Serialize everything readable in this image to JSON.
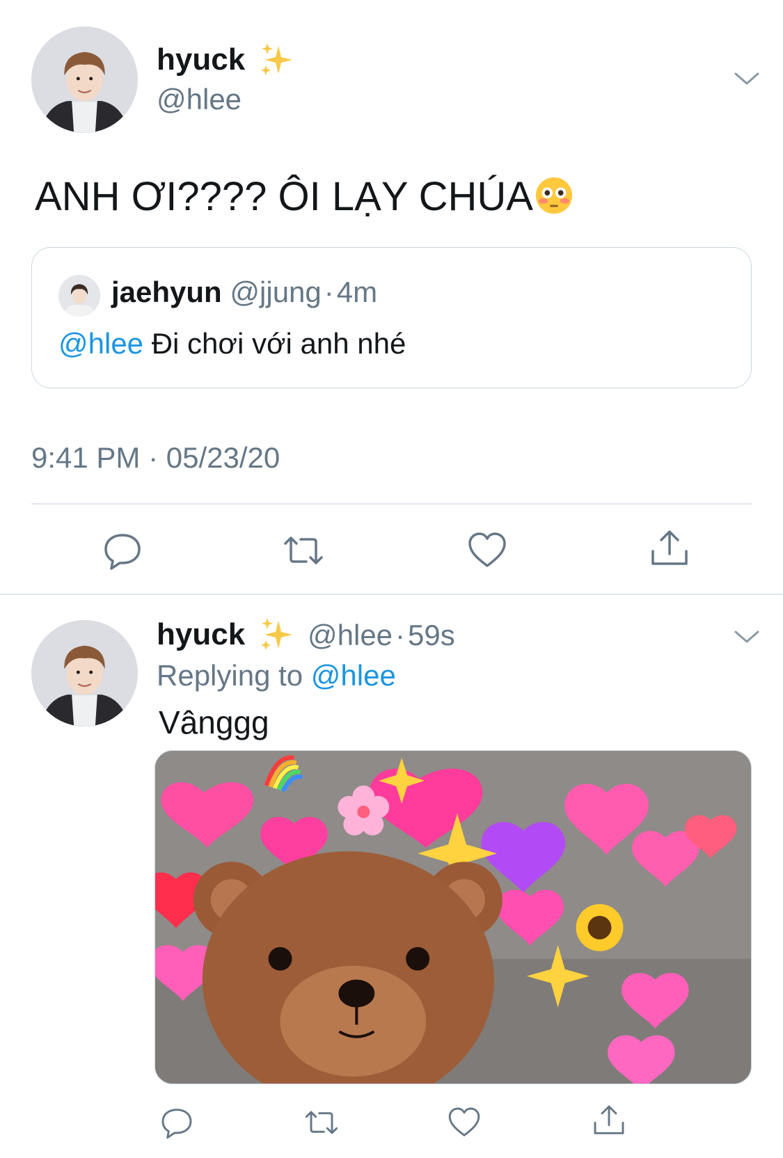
{
  "main_tweet": {
    "display_name": "hyuck",
    "name_emoji": "✨",
    "handle": "@hlee",
    "text": "ANH ƠI???? ÔI LẠY CHÚA",
    "text_emoji": "😳",
    "timestamp": "9:41 PM · 05/23/20",
    "quoted": {
      "display_name": "jaehyun",
      "handle": "@jjung",
      "separator": "·",
      "age": "4m",
      "mention": "@hlee",
      "text": "Đi chơi với anh nhé"
    }
  },
  "reply_tweet": {
    "display_name": "hyuck",
    "name_emoji": "✨",
    "handle": "@hlee",
    "separator": "·",
    "age": "59s",
    "replying_prefix": "Replying to",
    "replying_handle": "@hlee",
    "text": "Vânggg"
  },
  "actions": [
    "reply-icon",
    "retweet-icon",
    "like-icon",
    "share-icon"
  ],
  "colors": {
    "link": "#1b95e0",
    "muted": "#657786",
    "icon": "#657786",
    "border": "#ccd6dd"
  }
}
